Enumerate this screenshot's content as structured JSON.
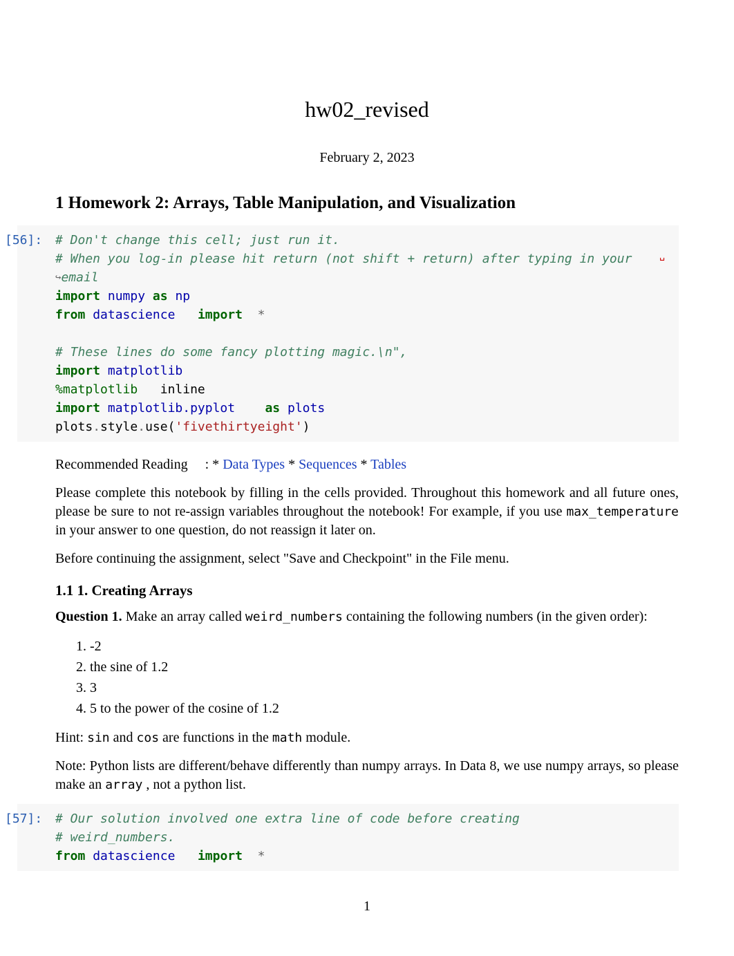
{
  "doc": {
    "title": "hw02_revised",
    "date": "February 2, 2023",
    "section1": "1     Homework 2: Arrays, Table Manipulation, and Visualization"
  },
  "cell56": {
    "prompt": "[56]:",
    "l1": "# Don't change this cell; just run it.",
    "l2a": "# When you log-in please hit return (not shift + return) after typing in your",
    "l2cont": "␣",
    "l2arrow": "↪",
    "l2b": "email",
    "l3_kw": "import",
    "l3_nm": "numpy",
    "l3_as": "as",
    "l3_alias": "np",
    "l4_from": "from",
    "l4_mod": "datascience",
    "l4_imp": "import",
    "l4_star": "*",
    "l5": "# These lines do some fancy plotting magic.\\n\",",
    "l6_kw": "import",
    "l6_nm": "matplotlib",
    "l7_mg": "%matplotlib",
    "l7_arg": "inline",
    "l8_kw": "import",
    "l8_nm": "matplotlib.pyplot",
    "l8_as": "as",
    "l8_alias": "plots",
    "l9_a": "plots",
    "l9_b": ".",
    "l9_c": "style",
    "l9_d": ".",
    "l9_e": "use(",
    "l9_str": "'fivethirtyeight'",
    "l9_f": ")"
  },
  "reading": {
    "prefix": "Recommended Reading",
    "colon_star": ": *",
    "link1": "Data Types",
    "star2": " * ",
    "link2": "Sequences",
    "star3": " * ",
    "link3": "Tables"
  },
  "para1a": "Please complete this notebook by filling in the cells provided. Throughout this homework and all future ones, please be sure to not re-assign variables throughout the notebook! For example, if you use ",
  "para1_mono": "max_temperature",
  "para1b": " in your answer to one question, do not reassign it later on.",
  "para2": "Before continuing the assignment, select \"Save and Checkpoint\" in the File menu.",
  "section11": "1.1     1. Creating Arrays",
  "q1": {
    "label": "Question 1.",
    "text1": "     Make an array called ",
    "mono": "weird_numbers",
    "text2": " containing the following numbers (in the given order):"
  },
  "listitems": {
    "i1": "-2",
    "i2": "the sine of 1.2",
    "i3": "3",
    "i4": "5 to the power of the cosine of 1.2"
  },
  "hint": {
    "a": "Hint: ",
    "sin": "sin",
    "and": " and ",
    "cos": "cos",
    "mid": " are functions in the ",
    "math": "math",
    "end": " module."
  },
  "note": {
    "a": "Note:  Python lists are different/behave differently than numpy arrays. In Data 8, we use numpy arrays, so please make an ",
    "arr": "array",
    "b": " , not a python list."
  },
  "cell57": {
    "prompt": "[57]:",
    "l1": "# Our solution involved one extra line of code before creating",
    "l2": "# weird_numbers.",
    "l3_from": "from",
    "l3_mod": "datascience",
    "l3_imp": "import",
    "l3_star": "*"
  },
  "pagenum": "1"
}
